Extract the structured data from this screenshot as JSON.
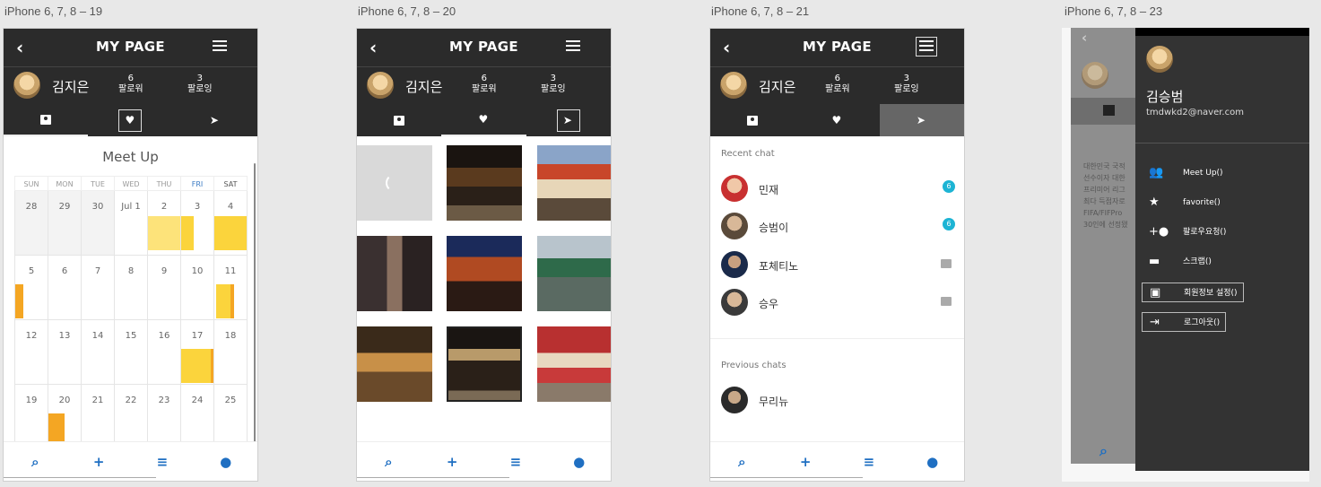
{
  "artboards": [
    "iPhone 6, 7, 8 – 19",
    "iPhone 6, 7, 8 – 20",
    "iPhone 6, 7, 8 – 21",
    "iPhone 6, 7, 8 – 23"
  ],
  "header": {
    "title": "MY PAGE",
    "back": "‹"
  },
  "profile": {
    "name": "김지은",
    "followers_count": "6",
    "followers_label": "팔로워",
    "following_count": "3",
    "following_label": "팔로잉"
  },
  "calendar": {
    "title": "Meet Up",
    "weekdays": [
      "SUN",
      "MON",
      "TUE",
      "WED",
      "THU",
      "FRI",
      "SAT"
    ],
    "weeks": [
      [
        "28",
        "29",
        "30",
        "Jul 1",
        "2",
        "3",
        "4"
      ],
      [
        "5",
        "6",
        "7",
        "8",
        "9",
        "10",
        "11"
      ],
      [
        "12",
        "13",
        "14",
        "15",
        "16",
        "17",
        "18"
      ],
      [
        "19",
        "20",
        "21",
        "22",
        "23",
        "24",
        "25"
      ]
    ]
  },
  "chat": {
    "recent_label": "Recent chat",
    "recent": [
      {
        "name": "민재",
        "badge": "6"
      },
      {
        "name": "승범이",
        "badge": "6"
      },
      {
        "name": "포체티노",
        "badge": ""
      },
      {
        "name": "승우",
        "badge": ""
      }
    ],
    "previous_label": "Previous chats",
    "previous": [
      {
        "name": "무리뉴"
      }
    ]
  },
  "drawer": {
    "name": "김승범",
    "email": "tmdwkd2@naver.com",
    "items": [
      "Meet Up()",
      "favorite()",
      "팔로우요청()",
      "스크랩()",
      "회원정보 설정()",
      "로그아웃()"
    ],
    "bg_text": [
      "대한민국 국적",
      "선수이자 대한",
      "프리미어 리그",
      "최다 득점자로",
      "FIFA/FIFPro",
      "30인에 선정됐"
    ]
  },
  "colors": {
    "accent": "#1f6fc2",
    "event_yellow": "#fbd43c",
    "event_orange": "#f4a623",
    "dark": "#2b2b2b",
    "badge": "#1db4d4"
  }
}
